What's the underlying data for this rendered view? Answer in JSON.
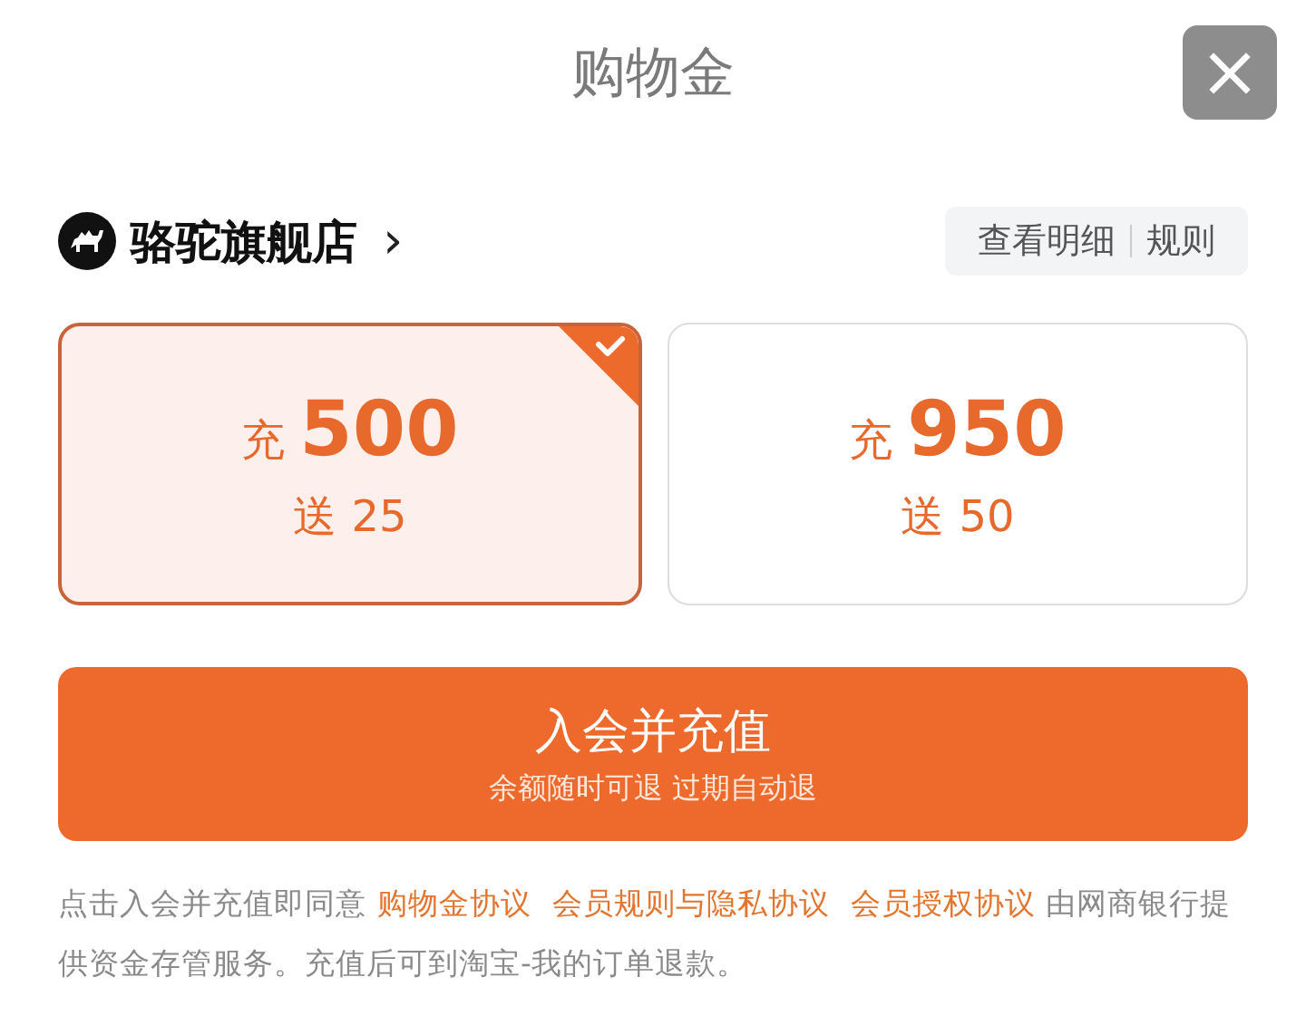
{
  "header": {
    "title": "购物金",
    "close": "×"
  },
  "shop": {
    "name": "骆驼旗舰店",
    "chevron": "›",
    "links": [
      "查看明细",
      "规则"
    ]
  },
  "options": [
    {
      "prefix": "充",
      "amount": "500",
      "bonus_prefix": "送",
      "bonus": "25",
      "selected": true
    },
    {
      "prefix": "充",
      "amount": "950",
      "bonus_prefix": "送",
      "bonus": "50",
      "selected": false
    }
  ],
  "submit": {
    "label": "入会并充值",
    "sublabel": "余额随时可退 过期自动退"
  },
  "agreement": [
    {
      "kind": "text",
      "text": "点击入会并充值即同意"
    },
    {
      "kind": "link",
      "text": "购物金协议"
    },
    {
      "kind": "link",
      "text": "会员规则与隐私协议"
    },
    {
      "kind": "link",
      "text": "会员授权协议"
    },
    {
      "kind": "text",
      "text": "由网商银行提供资金存管服务。充值后可到淘宝-我的订单退款。"
    }
  ]
}
